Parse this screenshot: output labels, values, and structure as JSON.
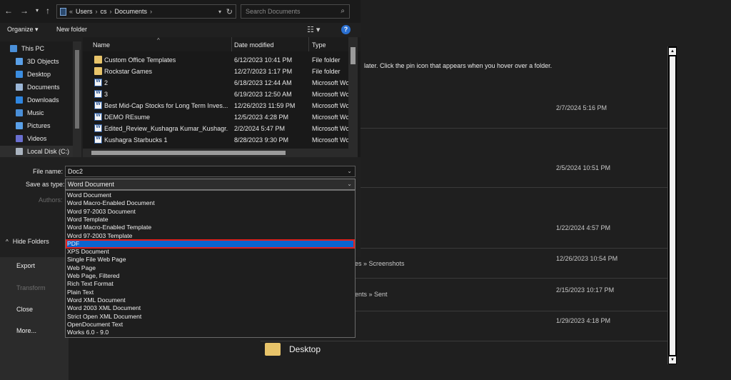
{
  "backstage": {
    "nav": [
      {
        "label": "Export",
        "disabled": false
      },
      {
        "label": "Transform",
        "disabled": true
      },
      {
        "label": "Close",
        "disabled": false
      },
      {
        "label": "More...",
        "disabled": false
      }
    ],
    "pin_hint": "later. Click the pin icon that appears when you hover over a folder.",
    "rows": [
      {
        "date": "2/7/2024 5:16 PM",
        "path": ""
      },
      {
        "date": "2/5/2024 10:51 PM",
        "path": ""
      },
      {
        "date": "1/22/2024 4:57 PM",
        "path": ""
      },
      {
        "date": "12/26/2023 10:54 PM",
        "path": "es » Screenshots"
      },
      {
        "date": "2/15/2023 10:17 PM",
        "path": "ents » Sent"
      },
      {
        "date": "1/29/2023 4:18 PM",
        "path": ""
      }
    ],
    "desktop_label": "Desktop"
  },
  "dialog": {
    "address": {
      "segments": [
        "«",
        "Users",
        "›",
        "cs",
        "›",
        "Documents",
        "›"
      ]
    },
    "search_placeholder": "Search Documents",
    "commands": {
      "organize": "Organize ▾",
      "new_folder": "New folder"
    },
    "tree": [
      {
        "label": "This PC",
        "color": "#4a8fd8"
      },
      {
        "label": "3D Objects",
        "color": "#5aa0e8"
      },
      {
        "label": "Desktop",
        "color": "#3b8de0"
      },
      {
        "label": "Documents",
        "color": "#9bb6d6"
      },
      {
        "label": "Downloads",
        "color": "#2f86e0"
      },
      {
        "label": "Music",
        "color": "#4a8fd8"
      },
      {
        "label": "Pictures",
        "color": "#5aa0e8"
      },
      {
        "label": "Videos",
        "color": "#6a6fd0"
      },
      {
        "label": "Local Disk (C:)",
        "color": "#aab4c0"
      }
    ],
    "columns": {
      "name": "Name",
      "date": "Date modified",
      "type": "Type"
    },
    "files": [
      {
        "name": "Custom Office Templates",
        "date": "6/12/2023 10:41 PM",
        "type": "File folder",
        "icon": "folder"
      },
      {
        "name": "Rockstar Games",
        "date": "12/27/2023 1:17 PM",
        "type": "File folder",
        "icon": "folder"
      },
      {
        "name": "2",
        "date": "6/18/2023 12:44 AM",
        "type": "Microsoft Wo",
        "icon": "word"
      },
      {
        "name": "3",
        "date": "6/19/2023 12:50 AM",
        "type": "Microsoft Wo",
        "icon": "word"
      },
      {
        "name": "Best Mid-Cap Stocks for Long Term Inves...",
        "date": "12/26/2023 11:59 PM",
        "type": "Microsoft Wo",
        "icon": "word"
      },
      {
        "name": "DEMO REsume",
        "date": "12/5/2023 4:28 PM",
        "type": "Microsoft Wo",
        "icon": "word"
      },
      {
        "name": "Edited_Review_Kushagra Kumar_Kushagr...",
        "date": "2/2/2024 5:47 PM",
        "type": "Microsoft Wo",
        "icon": "word"
      },
      {
        "name": "Kushagra Starbucks 1",
        "date": "8/28/2023 9:30 PM",
        "type": "Microsoft Wo",
        "icon": "word"
      }
    ],
    "file_name_label": "File name:",
    "file_name_value": "Doc2",
    "save_type_label": "Save as type:",
    "save_type_value": "Word Document",
    "authors_label": "Authors:",
    "hide_folders": "Hide Folders",
    "type_options": [
      "Word Document",
      "Word Macro-Enabled Document",
      "Word 97-2003 Document",
      "Word Template",
      "Word Macro-Enabled Template",
      "Word 97-2003 Template",
      "PDF",
      "XPS Document",
      "Single File Web Page",
      "Web Page",
      "Web Page, Filtered",
      "Rich Text Format",
      "Plain Text",
      "Word XML Document",
      "Word 2003 XML Document",
      "Strict Open XML Document",
      "OpenDocument Text",
      "Works 6.0 - 9.0"
    ],
    "selected_option": "PDF"
  }
}
